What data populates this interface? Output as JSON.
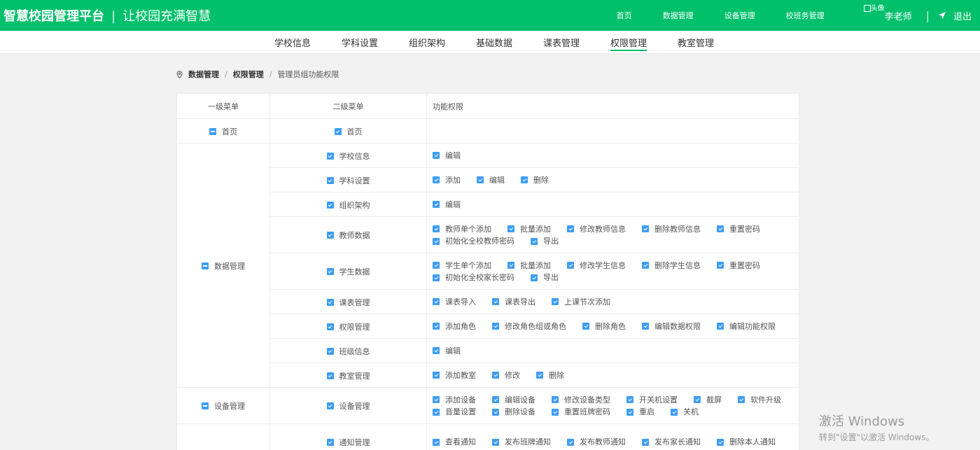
{
  "header": {
    "brand": "智慧校园管理平台",
    "separator": "|",
    "slogan": "让校园充满智慧",
    "nav": [
      "首页",
      "数据管理",
      "设备管理",
      "校班务管理"
    ],
    "avatar_alt": "头像",
    "user_name": "李老师",
    "divider": "|",
    "logout": "退出"
  },
  "subnav": [
    "学校信息",
    "学科设置",
    "组织架构",
    "基础数据",
    "课表管理",
    "权限管理",
    "教室管理"
  ],
  "breadcrumb": {
    "root": "数据管理",
    "sep": "/",
    "section": "权限管理",
    "current": "管理员组功能权限"
  },
  "table": {
    "headers": [
      "一级菜单",
      "二级菜单",
      "功能权限"
    ],
    "home": {
      "menu": "首页",
      "sub": "首页"
    },
    "data_mgmt": {
      "menu": "数据管理",
      "rows": [
        {
          "sub": "学校信息",
          "perms": [
            "编辑"
          ]
        },
        {
          "sub": "学科设置",
          "perms": [
            "添加",
            "编辑",
            "删除"
          ]
        },
        {
          "sub": "组织架构",
          "perms": [
            "编辑"
          ]
        },
        {
          "sub": "教师数据",
          "perms": [
            "教师单个添加",
            "批量添加",
            "修改教师信息",
            "删除教师信息",
            "重置密码",
            "初始化全校教师密码",
            "导出"
          ]
        },
        {
          "sub": "学生数据",
          "perms": [
            "学生单个添加",
            "批量添加",
            "修改学生信息",
            "删除学生信息",
            "重置密码",
            "初始化全校家长密码",
            "导出"
          ]
        },
        {
          "sub": "课表管理",
          "perms": [
            "课表导入",
            "课表导出",
            "上课节次添加"
          ]
        },
        {
          "sub": "权限管理",
          "perms": [
            "添加角色",
            "修改角色组或角色",
            "删除角色",
            "编辑数据权限",
            "编辑功能权限"
          ]
        },
        {
          "sub": "班级信息",
          "perms": [
            "编辑"
          ]
        },
        {
          "sub": "教室管理",
          "perms": [
            "添加教室",
            "修改",
            "删除"
          ]
        }
      ]
    },
    "device_mgmt": {
      "menu": "设备管理",
      "sub": "设备管理",
      "perms": [
        "添加设备",
        "编辑设备",
        "修改设备类型",
        "开关机设置",
        "截屏",
        "软件升级",
        "音量设置",
        "删除设备",
        "重置班牌密码",
        "重启",
        "关机"
      ]
    },
    "notice": {
      "sub": "通知管理",
      "perms": [
        "查看通知",
        "发布班牌通知",
        "发布教师通知",
        "发布家长通知",
        "删除本人通知"
      ]
    }
  },
  "watermark": {
    "line1": "激活 Windows",
    "line2": "转到\"设置\"以激活 Windows。"
  },
  "colors": {
    "brand_green": "#00c06b",
    "checkbox_blue": "#3e9df3"
  }
}
